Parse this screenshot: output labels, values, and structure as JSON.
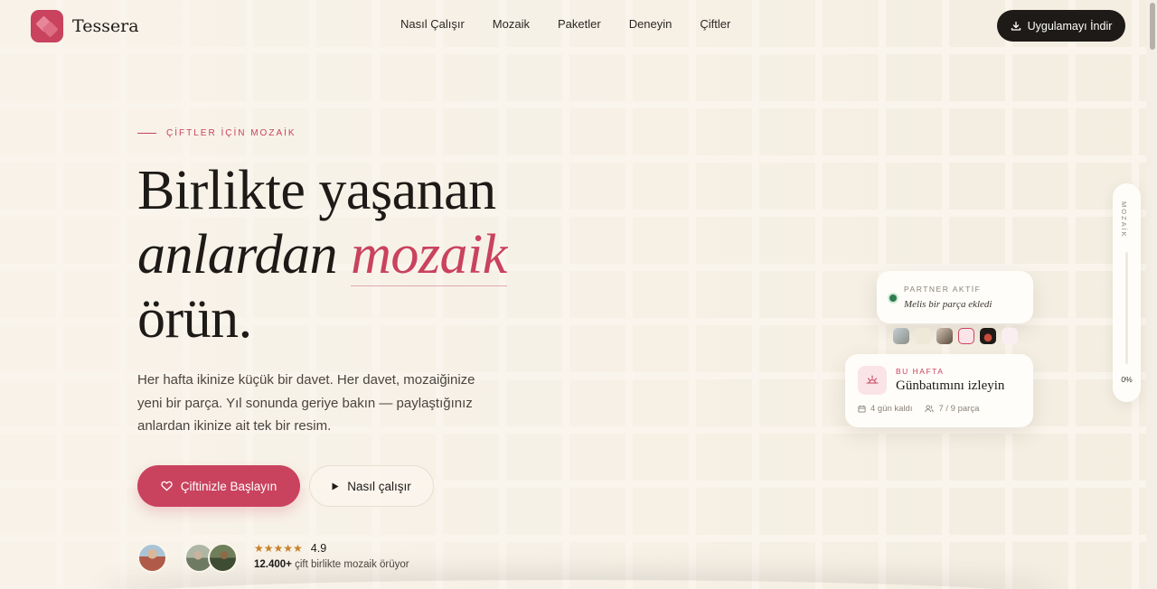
{
  "brand": {
    "name": "Tessera",
    "accent": "#c9425e",
    "dark": "#1d1a17",
    "background": "#faf5ec"
  },
  "nav": {
    "items": [
      {
        "label": "Nasıl Çalışır"
      },
      {
        "label": "Mozaik"
      },
      {
        "label": "Paketler"
      },
      {
        "label": "Deneyin"
      },
      {
        "label": "Çiftler"
      }
    ],
    "download_label": "Uygulamayı İndir",
    "download_icon": "download-icon"
  },
  "hero": {
    "eyebrow": "ÇİFTLER İÇİN MOZAİK",
    "headline_line1": "Birlikte yaşanan",
    "headline_line2_prefix": "anlardan ",
    "headline_accent": "mozaik",
    "headline_line3": "örün.",
    "lead": "Her hafta ikinize küçük bir davet. Her davet, mozaiğinize yeni bir parça. Yıl sonunda geriye bakın — paylaştığınız anlardan ikinize ait tek bir resim.",
    "cta_primary": "Çiftinizle Başlayın",
    "cta_primary_icon": "heart-icon",
    "cta_secondary": "Nasıl çalışır",
    "cta_secondary_icon": "play-icon"
  },
  "social_proof": {
    "rating": "4.9",
    "stars": "★★★★★",
    "count": "12.400+",
    "text": " çift birlikte mozaik örüyor"
  },
  "partner_card": {
    "label": "PARTNER AKTİF",
    "message": "Melis bir parça ekledi",
    "status_color": "#2e7d4f"
  },
  "week_card": {
    "label": "BU HAFTA",
    "title": "Günbatımını izleyin",
    "days_left": "4 gün kaldı",
    "pieces": "7 / 9 parça",
    "icon": "sunset-icon"
  },
  "progress_rail": {
    "label": "MOZAİK",
    "percent": "0%"
  }
}
